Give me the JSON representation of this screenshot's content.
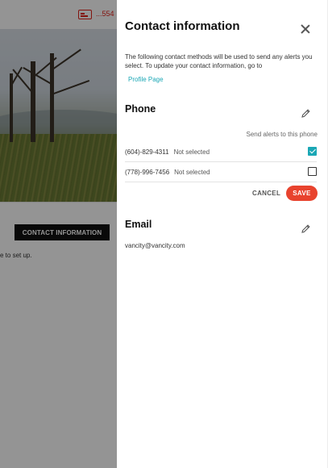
{
  "background": {
    "account_number": "...554",
    "contact_button_label": "CONTACT INFORMATION",
    "setup_text": "e to set up."
  },
  "panel": {
    "title": "Contact information",
    "description": "The following contact methods will be used to send any alerts you select. To update your contact information, go to",
    "profile_link": "Profile Page",
    "phone": {
      "title": "Phone",
      "column_header": "Send alerts to this phone",
      "rows": [
        {
          "number": "(604)-829-4311",
          "status": "Not selected",
          "checked": true
        },
        {
          "number": "(778)-996-7456",
          "status": "Not selected",
          "checked": false
        }
      ],
      "cancel_label": "CANCEL",
      "save_label": "SAVE"
    },
    "email": {
      "title": "Email",
      "address": "vancity@vancity.com"
    }
  },
  "colors": {
    "accent": "#1aa7b5",
    "save": "#e8432e",
    "brand_red": "#e2231a"
  }
}
